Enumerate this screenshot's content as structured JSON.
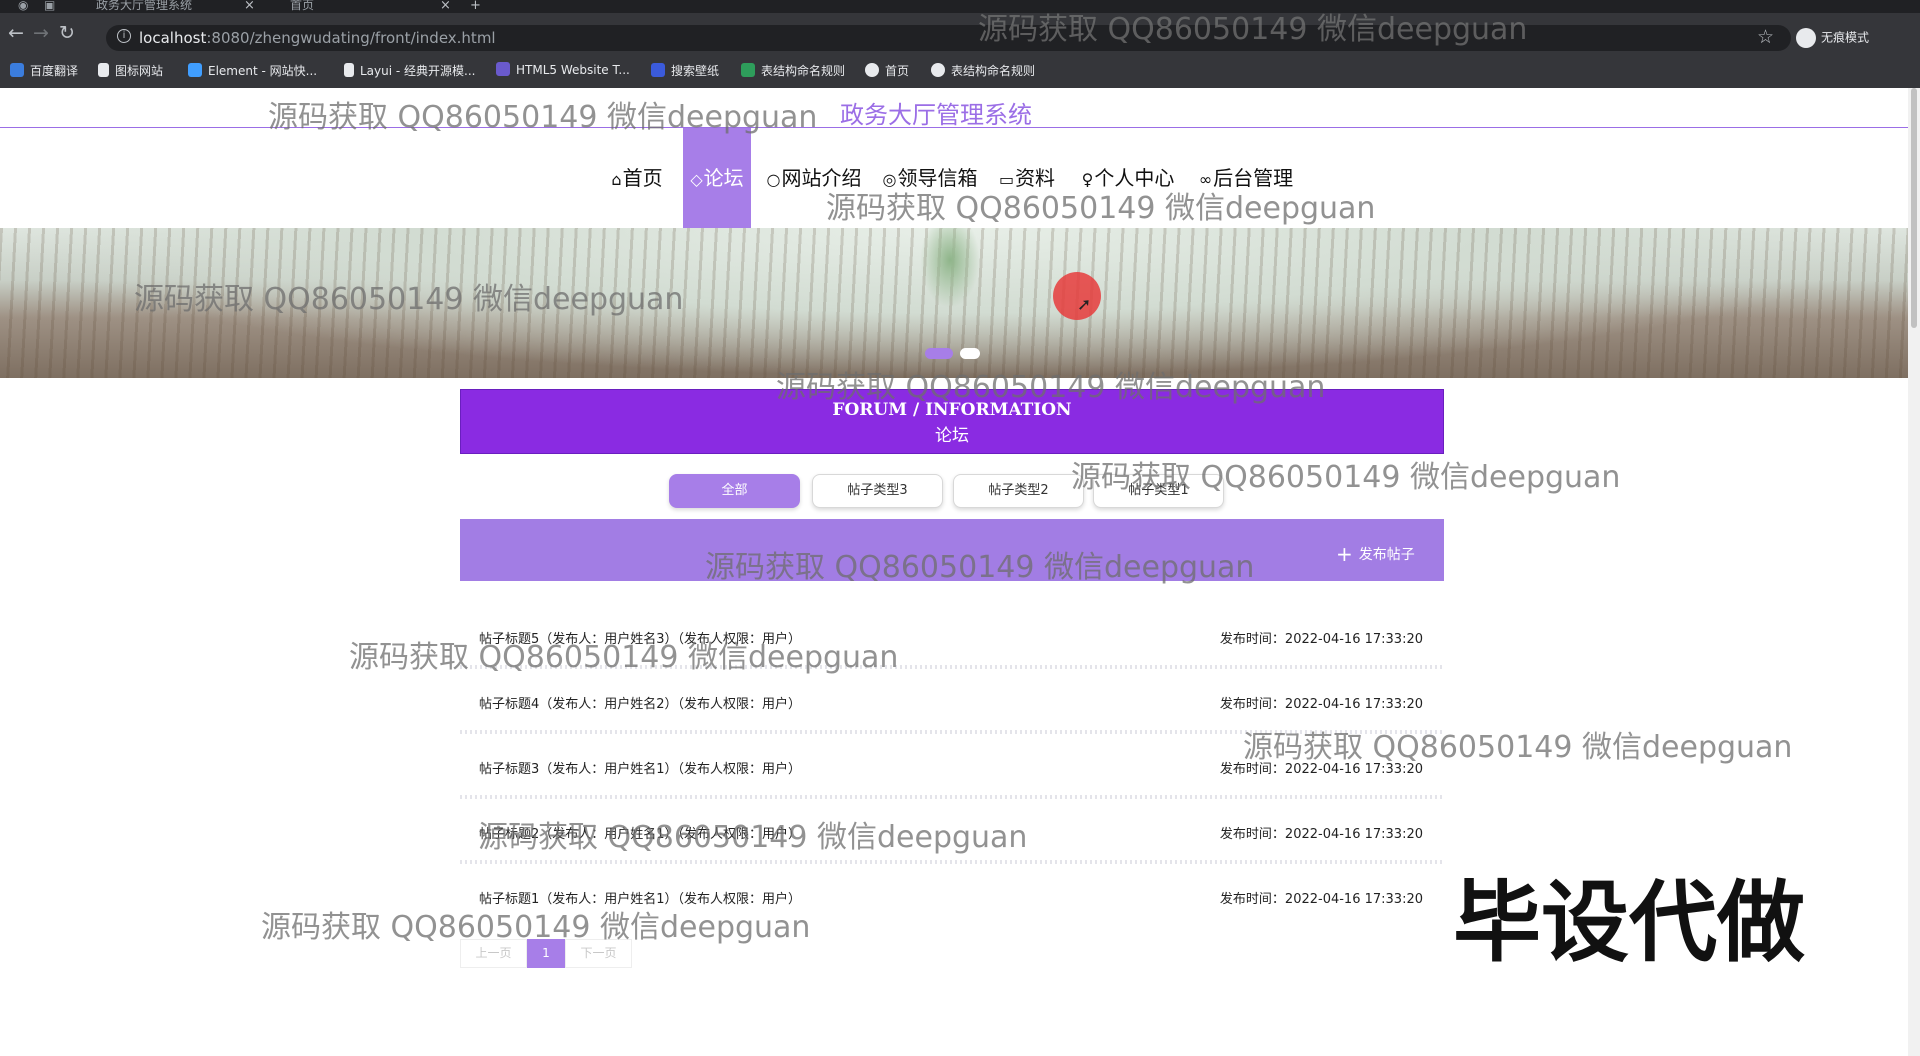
{
  "browser": {
    "tabs": [
      {
        "label": "政务大厅管理系统"
      },
      {
        "label": "首页"
      }
    ],
    "new_tab": "+",
    "url_host": "localhost",
    "url_rest": ":8080/zhengwudating/front/index.html",
    "profile_label": "无痕模式",
    "bookmarks": [
      "百度翻译",
      "图标网站",
      "Element - 网站快...",
      "Layui - 经典开源模...",
      "HTML5 Website T...",
      "搜索壁纸",
      "表结构命名规则",
      "首页",
      "表结构命名规则"
    ]
  },
  "site": {
    "title": "政务大厅管理系统",
    "nav": [
      {
        "label": "首页",
        "icon": "⌂"
      },
      {
        "label": "论坛",
        "icon": "◇"
      },
      {
        "label": "网站介绍",
        "icon": "○"
      },
      {
        "label": "领导信箱",
        "icon": "◎"
      },
      {
        "label": "资料",
        "icon": "▭"
      },
      {
        "label": "个人中心",
        "icon": "♀"
      },
      {
        "label": "后台管理",
        "icon": "∞"
      }
    ]
  },
  "forum": {
    "heading_en": "FORUM / INFORMATION",
    "heading_zh": "论坛",
    "filters": [
      "全部",
      "帖子类型3",
      "帖子类型2",
      "帖子类型1"
    ],
    "post_button": "发布帖子",
    "posts": [
      {
        "title": "帖子标题5（发布人：用户姓名3）（发布人权限：用户）",
        "time": "发布时间：2022-04-16 17:33:20"
      },
      {
        "title": "帖子标题4（发布人：用户姓名2）（发布人权限：用户）",
        "time": "发布时间：2022-04-16 17:33:20"
      },
      {
        "title": "帖子标题3（发布人：用户姓名1）（发布人权限：用户）",
        "time": "发布时间：2022-04-16 17:33:20"
      },
      {
        "title": "帖子标题2（发布人：用户姓名1）（发布人权限：用户）",
        "time": "发布时间：2022-04-16 17:33:20"
      },
      {
        "title": "帖子标题1（发布人：用户姓名1）（发布人权限：用户）",
        "time": "发布时间：2022-04-16 17:33:20"
      }
    ],
    "pagination": {
      "prev": "上一页",
      "current": "1",
      "next": "下一页"
    }
  },
  "watermarks": {
    "text": "源码获取 QQ86050149 微信deepguan",
    "big": "毕设代做"
  },
  "colors": {
    "accent": "#a77ee8",
    "forum_bar": "#8a2be2"
  }
}
